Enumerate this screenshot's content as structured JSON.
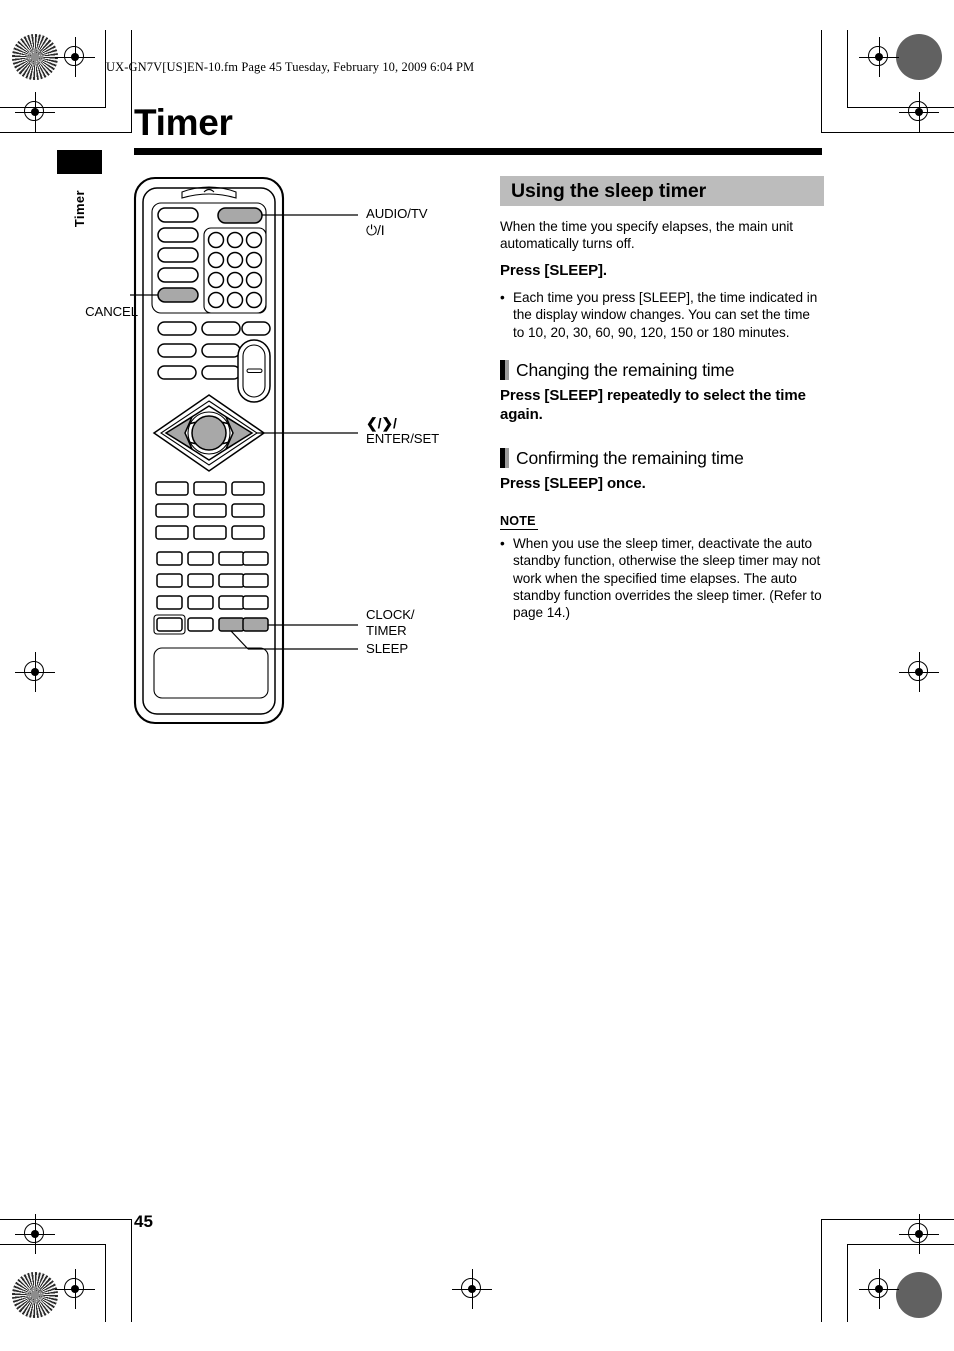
{
  "document": {
    "file_header": "UX-GN7V[US]EN-10.fm  Page 45  Tuesday, February 10, 2009  6:04 PM",
    "page_title": "Timer",
    "page_number": "45",
    "thumb_tab_label": "Timer"
  },
  "figure": {
    "name": "remote-control-diagram",
    "callouts": [
      {
        "id": "audio-tv",
        "line1": "AUDIO/TV",
        "line2": "⏻/I"
      },
      {
        "id": "cancel",
        "line1": "CANCEL",
        "line2": ""
      },
      {
        "id": "enter-set",
        "line1": "❮/❯/",
        "line2": "ENTER/SET"
      },
      {
        "id": "clock-timer",
        "line1": "CLOCK/",
        "line2": "TIMER"
      },
      {
        "id": "sleep",
        "line1": "SLEEP",
        "line2": ""
      }
    ]
  },
  "content": {
    "section_heading": "Using the sleep timer",
    "intro": "When the time you specify elapses, the main unit automatically turns off.",
    "press_sleep": "Press [SLEEP].",
    "press_sleep_bullet": "Each time you press [SLEEP], the time indicated in the display window changes. You can set the time to 10, 20, 30, 60, 90, 120, 150 or 180 minutes.",
    "subsections": [
      {
        "heading": "Changing the remaining time",
        "instruction": "Press [SLEEP] repeatedly to select the time again."
      },
      {
        "heading": "Confirming the remaining time",
        "instruction": "Press [SLEEP] once."
      }
    ],
    "note_label": "NOTE",
    "note_bullet": "When you use the sleep timer, deactivate the auto standby function, otherwise the sleep timer may not work when the specified time elapses. The auto standby function overrides the sleep timer. (Refer to page 14.)"
  },
  "colors": {
    "section_bar_bg": "#bcbcbc",
    "highlight_button": "#a8a8a8",
    "rule": "#000000"
  }
}
